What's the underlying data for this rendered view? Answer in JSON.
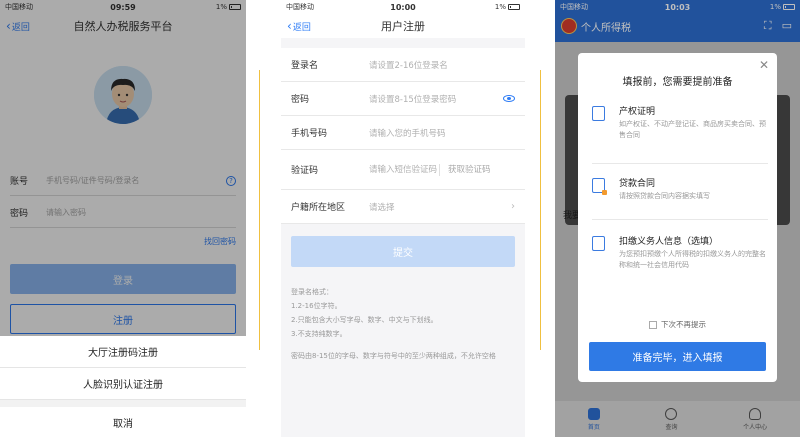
{
  "phone1": {
    "status": {
      "carrier": "中国移动",
      "time": "09:59",
      "battery": "1%"
    },
    "nav": {
      "back": "返回",
      "title": "自然人办税服务平台"
    },
    "account": {
      "label": "账号",
      "placeholder": "手机号码/证件号码/登录名",
      "help": "?"
    },
    "password": {
      "label": "密码",
      "placeholder": "请输入密码"
    },
    "forgot": "找回密码",
    "login": "登录",
    "register": "注册",
    "sheet": {
      "options": [
        "大厅注册码注册",
        "人脸识别认证注册"
      ],
      "cancel": "取消"
    }
  },
  "phone2": {
    "status": {
      "carrier": "中国移动",
      "time": "10:00",
      "battery": "1%"
    },
    "nav": {
      "back": "返回",
      "title": "用户注册"
    },
    "fields": [
      {
        "label": "登录名",
        "placeholder": "请设置2-16位登录名"
      },
      {
        "label": "密码",
        "placeholder": "请设置8-15位登录密码"
      },
      {
        "label": "手机号码",
        "placeholder": "请输入您的手机号码"
      },
      {
        "label": "验证码",
        "placeholder": "请输入短信验证码",
        "action": "获取验证码"
      },
      {
        "label": "户籍所在地区",
        "placeholder": "请选择"
      }
    ],
    "submit": "提交",
    "hint": [
      "登录名格式：",
      "1.2-16位字符。",
      "2.只能包含大小写字母、数字、中文与下划线。",
      "3.不支持纯数字。",
      "",
      "密码由8-15位的字母、数字与符号中的至少两种组成，不允许空格"
    ]
  },
  "phone3": {
    "status": {
      "carrier": "中国移动",
      "time": "10:03",
      "battery": "1%"
    },
    "header": {
      "title": "个人所得税"
    },
    "side_text": "我要",
    "modal": {
      "title": "填报前，您需要提前准备",
      "items": [
        {
          "title": "产权证明",
          "desc": "如产权证、不动产登记证、商品房买卖合同、预售合同"
        },
        {
          "title": "贷款合同",
          "desc": "请按照贷款合同内容据实填写"
        },
        {
          "title": "扣缴义务人信息（选填）",
          "desc": "为您预扣预缴个人所得税的扣缴义务人的完整名称和统一社会信用代码"
        }
      ],
      "checkbox": "下次不再提示",
      "confirm": "准备完毕，进入填报"
    },
    "tabs": [
      {
        "label": "首页"
      },
      {
        "label": "查询"
      },
      {
        "label": "个人中心"
      }
    ]
  }
}
